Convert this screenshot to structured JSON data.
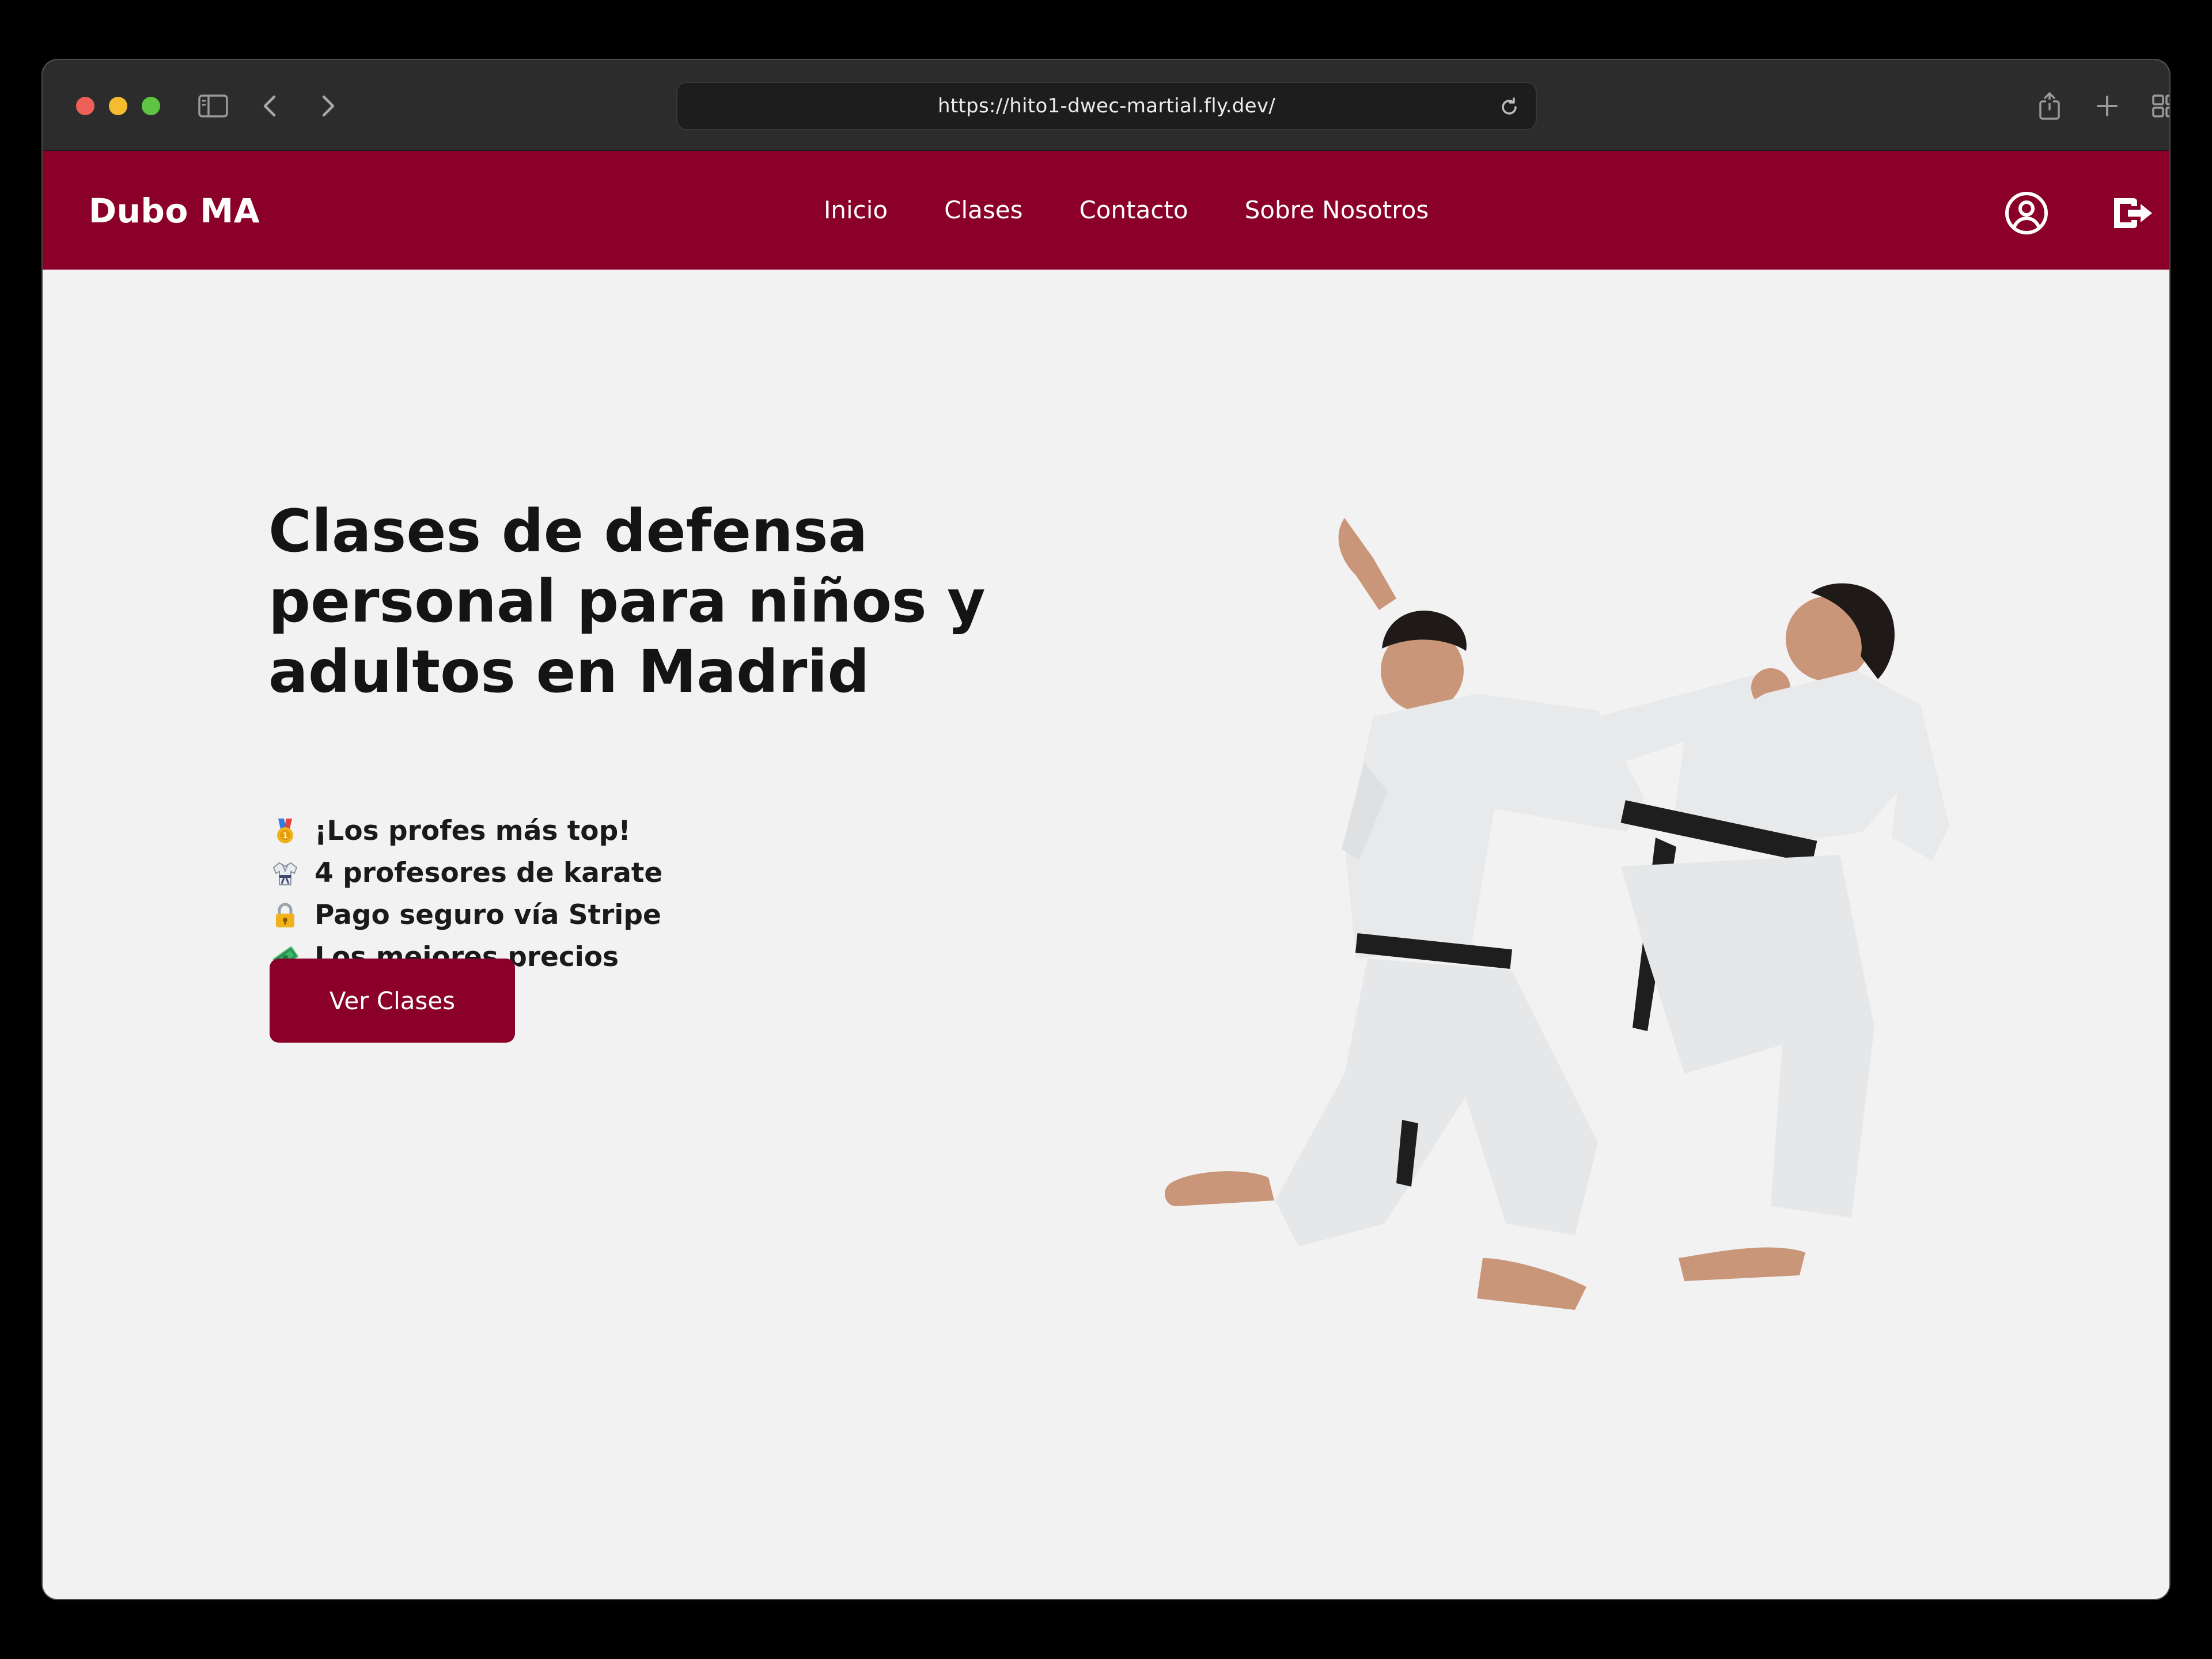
{
  "browser": {
    "url": "https://hito1-dwec-martial.fly.dev/",
    "icons": [
      "sidebar-icon",
      "back-icon",
      "forward-icon",
      "reload-icon",
      "share-icon",
      "new-tab-icon",
      "tab-overview-icon"
    ]
  },
  "site": {
    "brand": "Dubo MA",
    "nav": [
      "Inicio",
      "Clases",
      "Contacto",
      "Sobre Nosotros"
    ],
    "accent_color": "#8a0029",
    "icons": [
      "user-circle-icon",
      "logout-icon"
    ]
  },
  "hero": {
    "title_lines": [
      "Clases de defensa",
      "personal para niños y",
      "adultos en Madrid"
    ],
    "features": [
      {
        "icon": "medal-icon",
        "text": "¡Los profes más top!"
      },
      {
        "icon": "martial-arts-uniform-icon",
        "text": "4 profesores de karate"
      },
      {
        "icon": "lock-icon",
        "text": "Pago seguro vía Stripe"
      },
      {
        "icon": "money-icon",
        "text": "Los mejores precios"
      }
    ],
    "cta_label": "Ver Clases"
  }
}
